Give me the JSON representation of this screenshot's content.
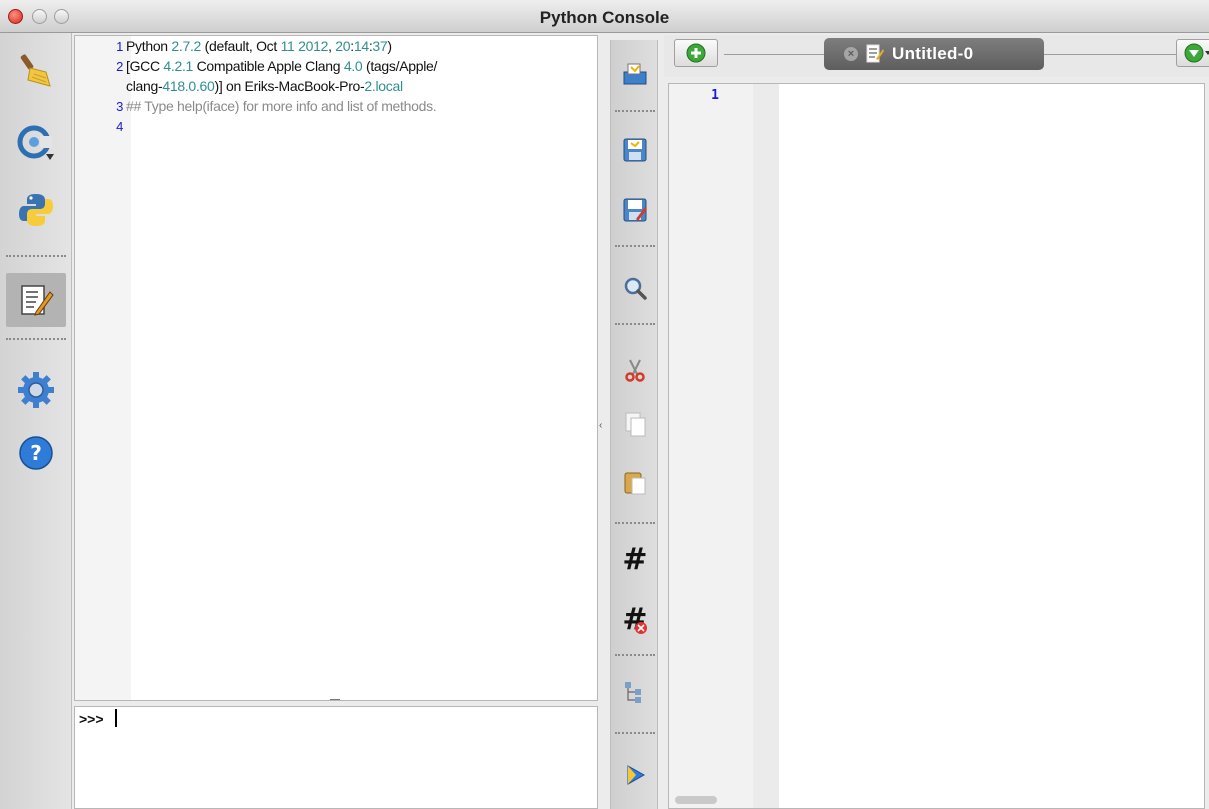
{
  "window": {
    "title": "Python Console"
  },
  "left_toolbar": {
    "items": [
      {
        "name": "clear-console",
        "icon": "broom-icon"
      },
      {
        "name": "import-class",
        "icon": "class-import-icon"
      },
      {
        "name": "run-command",
        "icon": "python-icon"
      },
      {
        "name": "show-editor",
        "icon": "editor-icon",
        "active": true
      },
      {
        "name": "settings",
        "icon": "gear-icon"
      },
      {
        "name": "help",
        "icon": "help-icon"
      }
    ]
  },
  "console": {
    "lines": [
      {
        "n": "1",
        "parts": [
          {
            "t": "Python ",
            "c": ""
          },
          {
            "t": "2.7.2",
            "c": "num"
          },
          {
            "t": " (default, Oct ",
            "c": ""
          },
          {
            "t": "11",
            "c": "num"
          },
          {
            "t": " ",
            "c": ""
          },
          {
            "t": "2012",
            "c": "num"
          },
          {
            "t": ", ",
            "c": ""
          },
          {
            "t": "20",
            "c": "num"
          },
          {
            "t": ":",
            "c": ""
          },
          {
            "t": "14",
            "c": "num"
          },
          {
            "t": ":",
            "c": ""
          },
          {
            "t": "37",
            "c": "num"
          },
          {
            "t": ")",
            "c": ""
          }
        ]
      },
      {
        "n": "2",
        "parts": [
          {
            "t": "[GCC ",
            "c": ""
          },
          {
            "t": "4.2.1",
            "c": "num"
          },
          {
            "t": " Compatible Apple Clang ",
            "c": ""
          },
          {
            "t": "4.0",
            "c": "num"
          },
          {
            "t": " (tags/Apple/",
            "c": ""
          }
        ]
      },
      {
        "n": "",
        "parts": [
          {
            "t": "clang-",
            "c": ""
          },
          {
            "t": "418.0.60",
            "c": "num"
          },
          {
            "t": ")] on Eriks-MacBook-Pro-",
            "c": ""
          },
          {
            "t": "2.local",
            "c": "num"
          }
        ]
      },
      {
        "n": "3",
        "parts": [
          {
            "t": "## Type help(iface) for more info and list of methods.",
            "c": "comment"
          }
        ]
      },
      {
        "n": "4",
        "parts": []
      }
    ],
    "prompt": ">>>",
    "input_value": ""
  },
  "mid_toolbar": {
    "items": [
      {
        "name": "open-file",
        "icon": "open-file-icon"
      },
      {
        "name": "save",
        "icon": "save-icon"
      },
      {
        "name": "save-as",
        "icon": "save-as-icon"
      },
      {
        "name": "find",
        "icon": "magnifier-icon"
      },
      {
        "name": "cut",
        "icon": "scissors-icon"
      },
      {
        "name": "copy",
        "icon": "copy-icon"
      },
      {
        "name": "paste",
        "icon": "paste-icon"
      },
      {
        "name": "comment",
        "icon": "hash-icon",
        "glyph": "#"
      },
      {
        "name": "uncomment",
        "icon": "hash-remove-icon",
        "glyph": "#"
      },
      {
        "name": "object-inspector",
        "icon": "tree-icon"
      },
      {
        "name": "run-script",
        "icon": "run-icon"
      }
    ]
  },
  "editor": {
    "tab_label": "Untitled-0",
    "tab_close_glyph": "×",
    "line_numbers": [
      "1"
    ]
  },
  "colors": {
    "line_number": "#1a1ad6",
    "number_literal": "#2f8f8f",
    "comment": "#8a8a8a"
  }
}
